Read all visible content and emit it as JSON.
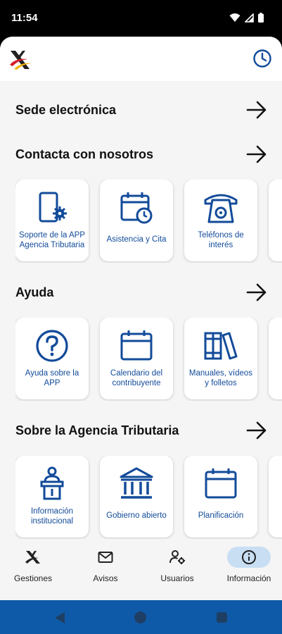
{
  "status_bar": {
    "time": "11:54"
  },
  "header": {
    "logo": "agencia-tributaria-logo",
    "history_icon": "clock-icon"
  },
  "sections": [
    {
      "title": "Sede electrónica",
      "cards": []
    },
    {
      "title": "Contacta con nosotros",
      "cards": [
        {
          "label": "Soporte de la APP Agencia Tributaria",
          "icon": "phone-gear-icon"
        },
        {
          "label": "Asistencia y Cita",
          "icon": "calendar-clock-icon"
        },
        {
          "label": "Teléfonos de interés",
          "icon": "telephone-icon"
        }
      ]
    },
    {
      "title": "Ayuda",
      "cards": [
        {
          "label": "Ayuda sobre la APP",
          "icon": "help-circle-icon"
        },
        {
          "label": "Calendario del contribuyente",
          "icon": "calendar-icon"
        },
        {
          "label": "Manuales, vídeos y folletos",
          "icon": "books-icon"
        }
      ]
    },
    {
      "title": "Sobre la Agencia Tributaria",
      "cards": [
        {
          "label": "Información institucional",
          "icon": "speaker-podium-icon"
        },
        {
          "label": "Gobierno abierto",
          "icon": "government-building-icon"
        },
        {
          "label": "Planificación",
          "icon": "calendar-icon"
        }
      ]
    }
  ],
  "bottom_nav": [
    {
      "label": "Gestiones",
      "icon": "agency-logo-icon",
      "active": false
    },
    {
      "label": "Avisos",
      "icon": "mail-icon",
      "active": false
    },
    {
      "label": "Usuarios",
      "icon": "user-gear-icon",
      "active": false
    },
    {
      "label": "Información",
      "icon": "info-icon",
      "active": true
    }
  ],
  "colors": {
    "accent": "#124b9a",
    "nav_active": "#c8def3",
    "system_nav": "#0f5aa8"
  }
}
